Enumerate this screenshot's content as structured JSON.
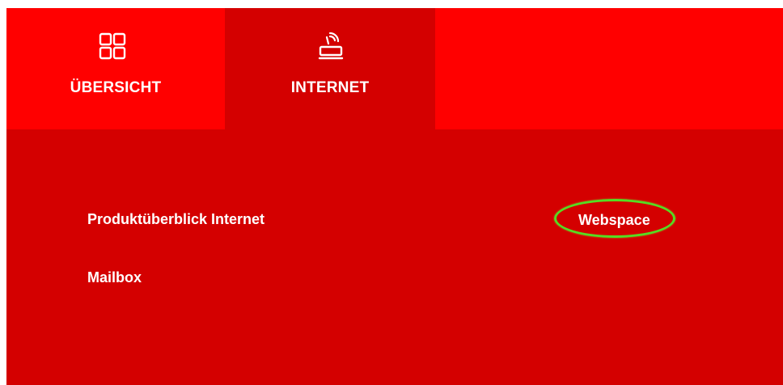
{
  "tabs": [
    {
      "label": "ÜBERSICHT",
      "icon": "grid-icon"
    },
    {
      "label": "INTERNET",
      "icon": "router-wifi-icon"
    }
  ],
  "links": {
    "product_overview": "Produktüberblick Internet",
    "mailbox": "Mailbox",
    "webspace": "Webspace"
  },
  "colors": {
    "brand_red": "#ff0000",
    "active_tab_red": "#d40000",
    "text": "#ffffff",
    "highlight": "#55dd22"
  }
}
